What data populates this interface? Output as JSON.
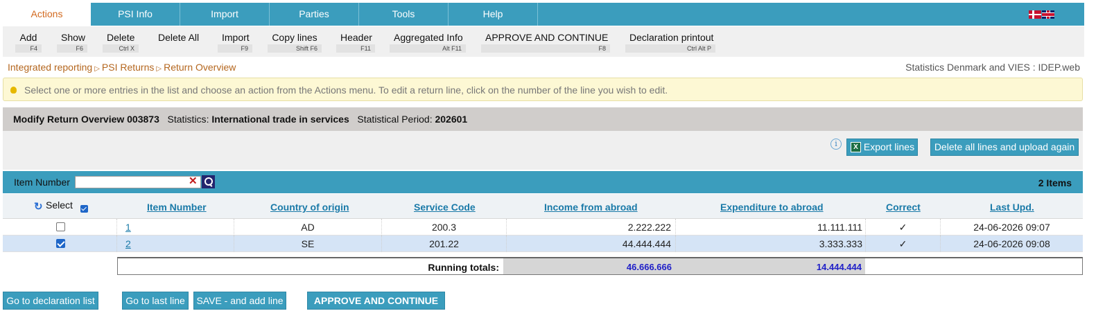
{
  "tabs": [
    {
      "label": "Actions",
      "active": true
    },
    {
      "label": "PSI Info"
    },
    {
      "label": "Import"
    },
    {
      "label": "Parties"
    },
    {
      "label": "Tools"
    },
    {
      "label": "Help"
    }
  ],
  "actions": [
    {
      "label": "Add",
      "key": "F4"
    },
    {
      "label": "Show",
      "key": "F6"
    },
    {
      "label": "Delete",
      "key": "Ctrl X"
    },
    {
      "label": "Delete All",
      "key": ""
    },
    {
      "label": "Import",
      "key": "F9"
    },
    {
      "label": "Copy lines",
      "key": "Shift F6"
    },
    {
      "label": "Header",
      "key": "F11"
    },
    {
      "label": "Aggregated Info",
      "key": "Alt F11"
    },
    {
      "label": "APPROVE AND CONTINUE",
      "key": "F8"
    },
    {
      "label": "Declaration printout",
      "key": "Ctrl Alt P"
    }
  ],
  "breadcrumb": [
    "Integrated reporting",
    "PSI Returns",
    "Return Overview"
  ],
  "app_name": "Statistics Denmark and VIES : IDEP.web",
  "info_message": "Select one or more entries in the list and choose an action from the Actions menu. To edit a return line, click on the number of the line you wish to edit.",
  "header": {
    "title": "Modify Return Overview 003873",
    "statistics_label": "Statistics",
    "statistics_value": "International trade in services",
    "period_label": "Statistical Period",
    "period_value": "202601"
  },
  "buttons": {
    "export": "Export lines",
    "delete_upload": "Delete all lines and upload again"
  },
  "filter": {
    "label": "Item Number",
    "value": "",
    "count": "2 Items"
  },
  "columns": {
    "select": "Select",
    "item_number": "Item Number",
    "country": "Country of origin",
    "service_code": "Service Code",
    "income": "Income from abroad",
    "expenditure": "Expenditure to abroad",
    "correct": "Correct",
    "last_upd": "Last Upd."
  },
  "rows": [
    {
      "checked": false,
      "item": "1",
      "country": "AD",
      "service": "200.3",
      "income": "2.222.222",
      "expenditure": "11.111.111",
      "correct": "✓",
      "last_upd": "24-06-2026 09:07"
    },
    {
      "checked": true,
      "item": "2",
      "country": "SE",
      "service": "201.22",
      "income": "44.444.444",
      "expenditure": "3.333.333",
      "correct": "✓",
      "last_upd": "24-06-2026 09:08"
    }
  ],
  "totals": {
    "label": "Running totals:",
    "income": "46.666.666",
    "expenditure": "14.444.444"
  },
  "bottom_buttons": {
    "declaration_list": "Go to declaration list",
    "last_line": "Go to last line",
    "save_add": "SAVE - and add line",
    "approve": "APPROVE AND CONTINUE"
  },
  "colors": {
    "accent": "#3b9dbd",
    "active_tab_text": "#d2691e",
    "totals_text": "#2020c8"
  }
}
